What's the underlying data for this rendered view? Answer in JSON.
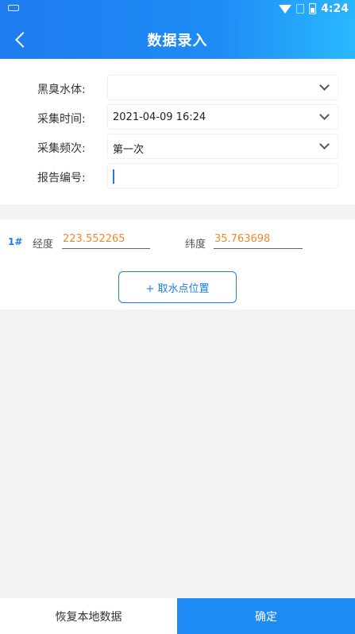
{
  "status_bar": {
    "time": "4:24"
  },
  "header": {
    "title": "数据录入"
  },
  "form": {
    "rows": [
      {
        "label": "黑臭水体:",
        "value": ""
      },
      {
        "label": "采集时间:",
        "value": "2021-04-09 16:24"
      },
      {
        "label": "采集频次:",
        "value": "第一次"
      },
      {
        "label": "报告编号:",
        "value": ""
      }
    ]
  },
  "coords": {
    "index": "1#",
    "lng_label": "经度",
    "lng_value": "223.552265",
    "lat_label": "纬度",
    "lat_value": "35.763698",
    "get_water_button": "+ 取水点位置"
  },
  "footer": {
    "restore_label": "恢复本地数据",
    "confirm_label": "确定"
  },
  "colors": {
    "primary": "#1e7cf0",
    "accent_value": "#f08a2a"
  }
}
